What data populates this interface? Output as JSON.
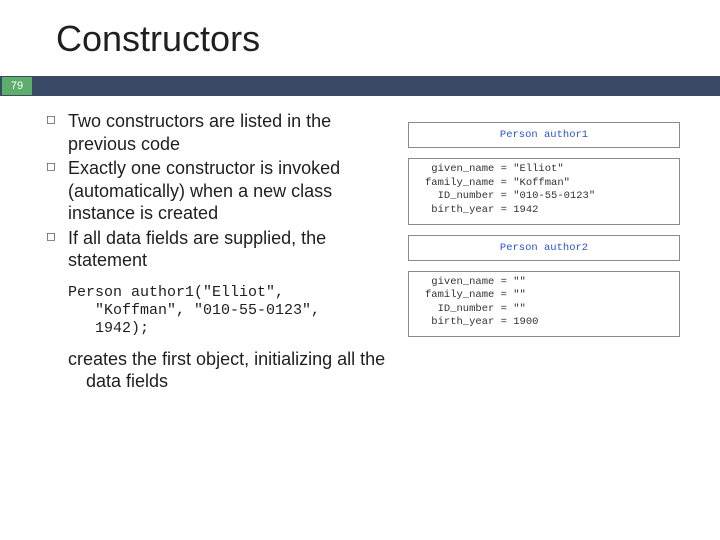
{
  "title": "Constructors",
  "page_number": "79",
  "bullets": [
    "Two constructors are listed in the previous code",
    "Exactly one constructor is invoked (automatically) when a new class instance is created",
    "If all data fields are supplied, the statement"
  ],
  "code_block": "Person author1(\"Elliot\",\n   \"Koffman\", \"010-55-0123\",\n   1942);",
  "after_code": "creates the first object, initializing all the data fields",
  "diagram": {
    "box1_head": "Person author1",
    "box1_body": " given_name = \"Elliot\"\nfamily_name = \"Koffman\"\n  ID_number = \"010-55-0123\"\n birth_year = 1942",
    "box2_head": "Person author2",
    "box2_body": " given_name = \"\"\nfamily_name = \"\"\n  ID_number = \"\"\n birth_year = 1900"
  }
}
